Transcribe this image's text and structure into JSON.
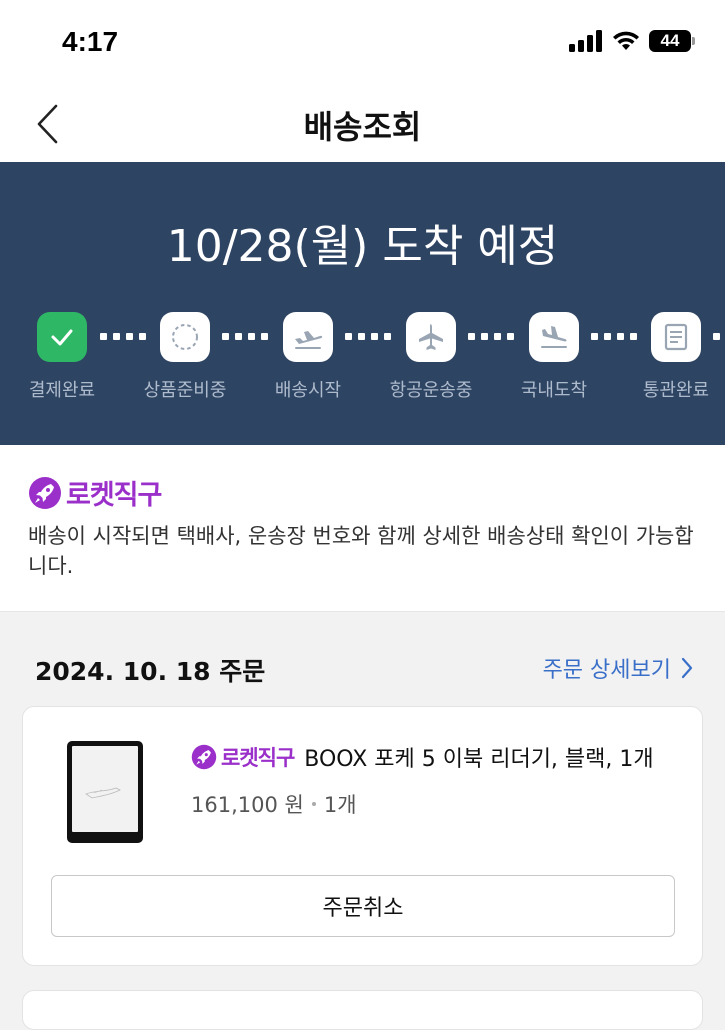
{
  "status_bar": {
    "time": "4:17",
    "battery": "44"
  },
  "header": {
    "title": "배송조회",
    "back_icon": "chevron-left-icon"
  },
  "delivery": {
    "eta": "10/28(월) 도착 예정",
    "steps": [
      {
        "label": "결제완료",
        "icon": "check-icon",
        "status": "done"
      },
      {
        "label": "상품준비중",
        "icon": "dashed-circle-icon",
        "status": "pending"
      },
      {
        "label": "배송시작",
        "icon": "plane-takeoff-icon",
        "status": "pending"
      },
      {
        "label": "항공운송중",
        "icon": "plane-icon",
        "status": "pending"
      },
      {
        "label": "국내도착",
        "icon": "plane-landing-icon",
        "status": "pending"
      },
      {
        "label": "통관완료",
        "icon": "document-icon",
        "status": "pending"
      }
    ]
  },
  "rocket": {
    "brand": "로켓직구",
    "description": "배송이 시작되면 택배사, 운송장 번호와 함께 상세한 배송상태 확인이 가능합니다."
  },
  "order": {
    "date": "2024. 10. 18 주문",
    "detail_link": "주문 상세보기",
    "item": {
      "brand": "로켓직구",
      "name": "BOOX 포케 5 이북 리더기, 블랙, 1개",
      "price": "161,100 원",
      "quantity": "1개"
    },
    "cancel_label": "주문취소"
  },
  "colors": {
    "hero_bg": "#2e4463",
    "done_green": "#2eb865",
    "rocket_purple": "#9a2fc9",
    "link_blue": "#3a6fc9"
  }
}
